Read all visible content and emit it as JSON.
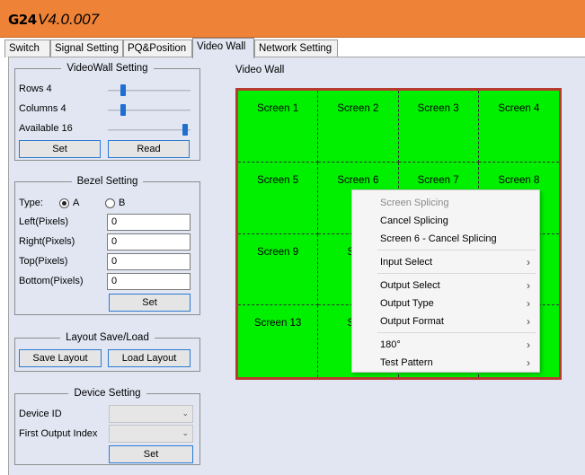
{
  "app": {
    "logo": "G24",
    "version": "V4.0.007"
  },
  "tabs": [
    "Switch",
    "Signal Setting",
    "PQ&Position",
    "Video Wall",
    "Network Setting"
  ],
  "videowall_setting": {
    "title": "VideoWall Setting",
    "rows_label": "Rows 4",
    "columns_label": "Columns 4",
    "available_label": "Available 16",
    "rows_level": 0.25,
    "columns_level": 0.25,
    "available_level": 1.0,
    "set": "Set",
    "read": "Read"
  },
  "bezel_setting": {
    "title": "Bezel Setting",
    "type_label": "Type:",
    "option_a": "A",
    "option_b": "B",
    "left_label": "Left(Pixels)",
    "right_label": "Right(Pixels)",
    "top_label": "Top(Pixels)",
    "bottom_label": "Bottom(Pixels)",
    "left_value": "0",
    "right_value": "0",
    "top_value": "0",
    "bottom_value": "0",
    "set": "Set"
  },
  "layout": {
    "title": "Layout Save/Load",
    "save": "Save Layout",
    "load": "Load Layout"
  },
  "device_setting": {
    "title": "Device Setting",
    "device_id_label": "Device ID",
    "first_output_label": "First Output Index",
    "set": "Set"
  },
  "video_wall": {
    "title": "Video Wall",
    "screens": [
      "Screen 1",
      "Screen 2",
      "Screen 3",
      "Screen 4",
      "Screen 5",
      "Screen 6",
      "Screen 7",
      "Screen 8",
      "Screen 9",
      "Scre",
      "",
      "2",
      "Screen 13",
      "Scre",
      "",
      "6"
    ]
  },
  "context_menu": {
    "items": [
      {
        "label": "Screen Splicing",
        "disabled": true,
        "submenu": false
      },
      {
        "label": "Cancel Splicing",
        "disabled": false,
        "submenu": false
      },
      {
        "label": "Screen 6 - Cancel Splicing",
        "disabled": false,
        "submenu": false
      },
      {
        "label": "Input Select",
        "disabled": false,
        "submenu": true
      },
      {
        "label": "Output Select",
        "disabled": false,
        "submenu": true
      },
      {
        "label": "Output Type",
        "disabled": false,
        "submenu": true
      },
      {
        "label": "Output Format",
        "disabled": false,
        "submenu": true
      },
      {
        "label": "180°",
        "disabled": false,
        "submenu": true
      },
      {
        "label": "Test Pattern",
        "disabled": false,
        "submenu": true
      }
    ],
    "submenu_glyph": "›"
  },
  "icons": {
    "dropdown": "chevron-down-icon",
    "submenu": "chevron-right-icon"
  },
  "colors": {
    "titlebar": "#ee8338",
    "wall_bg": "#00f000",
    "wall_border": "#b73a2f",
    "accent": "#1f6fd1"
  }
}
